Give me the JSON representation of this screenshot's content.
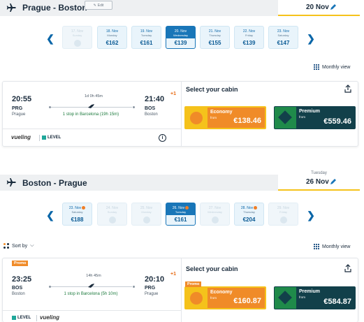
{
  "outbound": {
    "route_title": "Prague - Boston",
    "edit_label": "Edit",
    "weekday": "",
    "date": "20 Nov",
    "days": [
      {
        "date": "17. Nov",
        "weekday": "Sunday",
        "price": ""
      },
      {
        "date": "18. Nov",
        "weekday": "Monday",
        "price": "€162"
      },
      {
        "date": "19. Nov",
        "weekday": "Tuesday",
        "price": "€161"
      },
      {
        "date": "20. Nov",
        "weekday": "Wednesday",
        "price": "€139"
      },
      {
        "date": "21. Nov",
        "weekday": "Thursday",
        "price": "€155"
      },
      {
        "date": "22. Nov",
        "weekday": "Friday",
        "price": "€139"
      },
      {
        "date": "23. Nov",
        "weekday": "Saturday",
        "price": "€147"
      }
    ],
    "monthly_view": "Monthly view",
    "flight": {
      "dep_time": "20:55",
      "dep_code": "PRG",
      "dep_city": "Prague",
      "arr_time": "21:40",
      "arr_code": "BOS",
      "arr_city": "Boston",
      "plus_day": "+1",
      "duration": "1d 0h 45m",
      "stops": "1 stop in Barcelona (19h 15m)",
      "airline1": "vueling",
      "airline2": "LEVEL"
    },
    "cabin_title": "Select your cabin",
    "economy": {
      "name": "Economy",
      "from": "from",
      "price": "€138.46"
    },
    "premium": {
      "name": "Premium",
      "from": "from",
      "price": "€559.46"
    }
  },
  "return": {
    "route_title": "Boston - Prague",
    "weekday": "Tuesday",
    "date": "26 Nov",
    "days": [
      {
        "date": "23. Nov",
        "weekday": "Saturday",
        "price": "€188"
      },
      {
        "date": "24. Nov",
        "weekday": "Sunday",
        "price": ""
      },
      {
        "date": "25. Nov",
        "weekday": "Monday",
        "price": ""
      },
      {
        "date": "26. Nov",
        "weekday": "Tuesday",
        "price": "€161"
      },
      {
        "date": "27. Nov",
        "weekday": "Wednesday",
        "price": ""
      },
      {
        "date": "28. Nov",
        "weekday": "Thursday",
        "price": "€204"
      },
      {
        "date": "29. Nov",
        "weekday": "Friday",
        "price": ""
      }
    ],
    "sort_by": "Sort by",
    "monthly_view": "Monthly view",
    "promo": "Promo",
    "flight": {
      "dep_time": "23:25",
      "dep_code": "BOS",
      "dep_city": "Boston",
      "arr_time": "20:10",
      "arr_code": "PRG",
      "arr_city": "Prague",
      "plus_day": "+1",
      "duration": "14h 45m",
      "stops": "1 stop in Barcelona (5h 10m)",
      "airline1": "LEVEL",
      "airline2": "vueling"
    },
    "cabin_title": "Select your cabin",
    "economy": {
      "name": "Economy",
      "from": "from",
      "price": "€160.87",
      "promo": "Promo"
    },
    "premium": {
      "name": "Premium",
      "from": "from",
      "price": "€584.87"
    }
  },
  "colors": {
    "accent": "#1976b8",
    "economy": "#f08b28",
    "premium": "#12404a",
    "highlight": "#f5c21b"
  }
}
